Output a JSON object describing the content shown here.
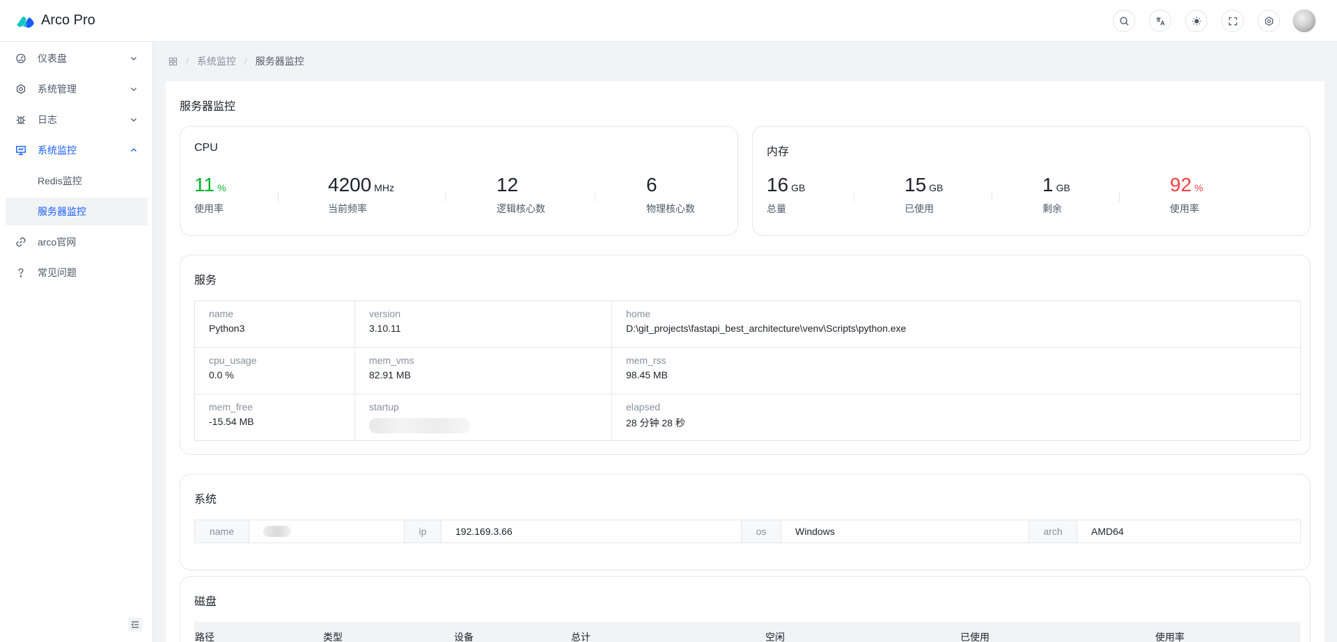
{
  "app": {
    "title": "Arco Pro"
  },
  "colors": {
    "primary": "#165dff",
    "success": "#00b42a",
    "danger": "#f53f3f"
  },
  "header": {
    "icons": [
      "search-icon",
      "language-icon",
      "theme-icon",
      "fullscreen-icon",
      "settings-icon"
    ]
  },
  "sidebar": {
    "items": [
      {
        "label": "仪表盘",
        "icon": "dashboard-icon"
      },
      {
        "label": "系统管理",
        "icon": "gear-icon"
      },
      {
        "label": "日志",
        "icon": "bug-icon"
      },
      {
        "label": "系统监控",
        "icon": "monitor-icon"
      },
      {
        "label": "Redis监控"
      },
      {
        "label": "服务器监控"
      },
      {
        "label": "arco官网",
        "icon": "link-icon"
      },
      {
        "label": "常见问题",
        "icon": "question-icon"
      }
    ]
  },
  "breadcrumb": {
    "items": [
      "系统监控",
      "服务器监控"
    ]
  },
  "page": {
    "title": "服务器监控"
  },
  "cpu": {
    "title": "CPU",
    "stats": [
      {
        "value": "11",
        "unit": "%",
        "label": "使用率"
      },
      {
        "value": "4200",
        "unit": "MHz",
        "label": "当前频率"
      },
      {
        "value": "12",
        "unit": "",
        "label": "逻辑核心数"
      },
      {
        "value": "6",
        "unit": "",
        "label": "物理核心数"
      }
    ]
  },
  "memory": {
    "title": "内存",
    "stats": [
      {
        "value": "16",
        "unit": "GB",
        "label": "总量"
      },
      {
        "value": "15",
        "unit": "GB",
        "label": "已使用"
      },
      {
        "value": "1",
        "unit": "GB",
        "label": "剩余"
      },
      {
        "value": "92",
        "unit": "%",
        "label": "使用率"
      }
    ]
  },
  "service": {
    "title": "服务",
    "rows": [
      [
        {
          "k": "name",
          "v": "Python3"
        },
        {
          "k": "version",
          "v": "3.10.11"
        },
        {
          "k": "home",
          "v": "D:\\git_projects\\fastapi_best_architecture\\venv\\Scripts\\python.exe"
        }
      ],
      [
        {
          "k": "cpu_usage",
          "v": "0.0 %"
        },
        {
          "k": "mem_vms",
          "v": "82.91 MB"
        },
        {
          "k": "mem_rss",
          "v": "98.45 MB"
        }
      ],
      [
        {
          "k": "mem_free",
          "v": "-15.54 MB"
        },
        {
          "k": "startup",
          "v": ""
        },
        {
          "k": "elapsed",
          "v": "28 分钟 28 秒"
        }
      ]
    ]
  },
  "system": {
    "title": "系统",
    "fields": [
      {
        "k": "name",
        "v": ""
      },
      {
        "k": "ip",
        "v": "192.169.3.66"
      },
      {
        "k": "os",
        "v": "Windows"
      },
      {
        "k": "arch",
        "v": "AMD64"
      }
    ]
  },
  "disk": {
    "title": "磁盘",
    "columns": [
      "路径",
      "类型",
      "设备",
      "总计",
      "空闲",
      "已使用",
      "使用率"
    ]
  }
}
